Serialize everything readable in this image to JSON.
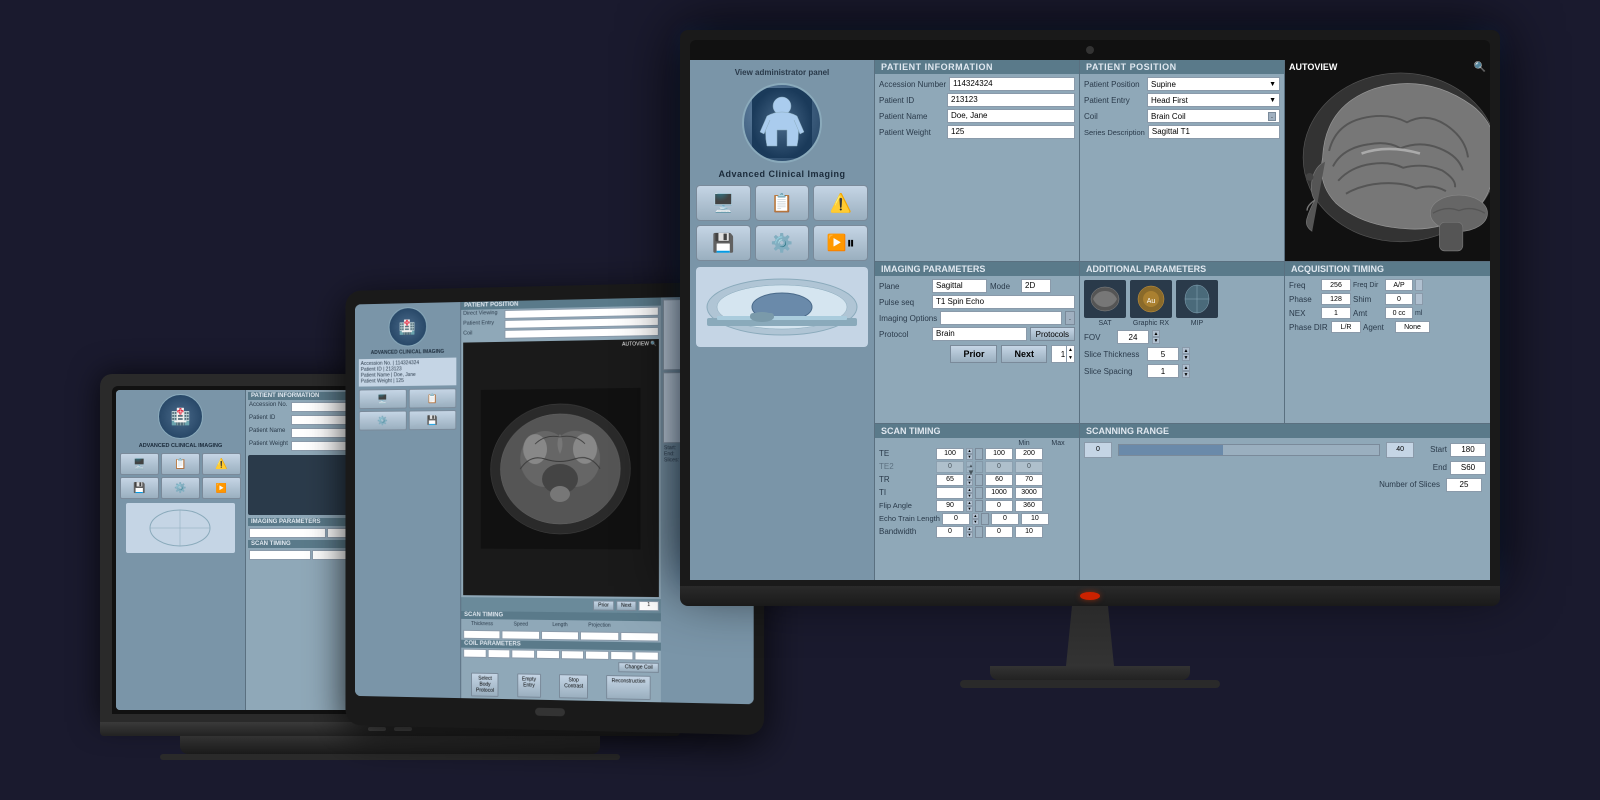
{
  "app": {
    "title": "Advanced Clinical Imaging",
    "logo_text": "🏥",
    "admin_panel_label": "View administrator panel"
  },
  "patient": {
    "accession_number_label": "Accession Number",
    "accession_number_value": "114324324",
    "patient_id_label": "Patient ID",
    "patient_id_value": "213123",
    "patient_name_label": "Patient Name",
    "patient_name_value": "Doe, Jane",
    "patient_weight_label": "Patient Weight",
    "patient_weight_value": "125"
  },
  "patient_position": {
    "section_label": "PATIENT POSITION",
    "position_label": "Patient Position",
    "position_value": "Supine",
    "entry_label": "Patient Entry",
    "entry_value": "Head First",
    "coil_label": "Coil",
    "coil_value": "Brain Coil",
    "series_desc_label": "Series Description",
    "series_desc_value": "Sagittal T1"
  },
  "imaging_params": {
    "section_label": "IMAGING PARAMETERS",
    "plane_label": "Plane",
    "plane_value": "Sagittal",
    "mode_label": "Mode",
    "mode_value": "2D",
    "pulse_seq_label": "Pulse seq",
    "pulse_seq_value": "T1 Spin Echo",
    "imaging_options_label": "Imaging Options",
    "protocol_label": "Protocol",
    "protocol_value": "Brain",
    "protocols_btn": "Protocols",
    "prior_btn": "Prior",
    "next_btn": "Next"
  },
  "scan_timing": {
    "section_label": "SCAN TIMING",
    "min_label": "Min",
    "max_label": "Max",
    "te_label": "TE",
    "te_value": "100",
    "te_min": "100",
    "te_max": "200",
    "te2_label": "TE2",
    "te2_value": "0",
    "tr_label": "TR",
    "tr_value": "65",
    "tr_min": "60",
    "tr_max": "70",
    "ti_label": "TI",
    "ti_value": "",
    "ti_min": "1000",
    "ti_max": "3000",
    "flip_angle_label": "Flip Angle",
    "flip_angle_value": "90",
    "flip_min": "0",
    "flip_max": "360",
    "echo_train_label": "Echo Train Length",
    "echo_train_value": "0",
    "echo_min": "0",
    "echo_max": "10",
    "bandwidth_label": "Bandwidth",
    "bandwidth_value": "0",
    "bandwidth_min": "0",
    "bandwidth_max": "10"
  },
  "additional_params": {
    "section_label": "ADDITIONAL PARAMETERS",
    "sat_label": "SAT",
    "graphic_rx_label": "Graphic RX",
    "mip_label": "MIP",
    "fov_label": "FOV",
    "fov_value": "24",
    "slice_thickness_label": "Slice Thickness",
    "slice_thickness_value": "5",
    "slice_spacing_label": "Slice Spacing",
    "slice_spacing_value": "1"
  },
  "acquisition_timing": {
    "section_label": "ACQUISITION TIMING",
    "freq_label": "Freq",
    "freq_value": "256",
    "freq_dir_label": "Freq Dir",
    "freq_dir_value": "A/P",
    "phase_label": "Phase",
    "phase_value": "128",
    "shim_label": "Shim",
    "shim_value": "0",
    "nex_label": "NEX",
    "nex_value": "1",
    "amt_label": "Amt",
    "amt_value": "0 cc",
    "phase_dir_label": "Phase DIR",
    "phase_dir_value": "L/R",
    "agent_label": "Agent",
    "agent_value": "None"
  },
  "scanning_range": {
    "section_label": "SCANNING RANGE",
    "val_0": "0",
    "val_40": "40",
    "start_label": "Start",
    "start_value": "180",
    "end_label": "End",
    "end_value": "S60",
    "num_slices_label": "Number of Slices",
    "num_slices_value": "25"
  },
  "autoview": {
    "label": "AUTOVIEW",
    "search_icon": "🔍"
  },
  "patient_info_section": "PATIENT INFORMATION"
}
